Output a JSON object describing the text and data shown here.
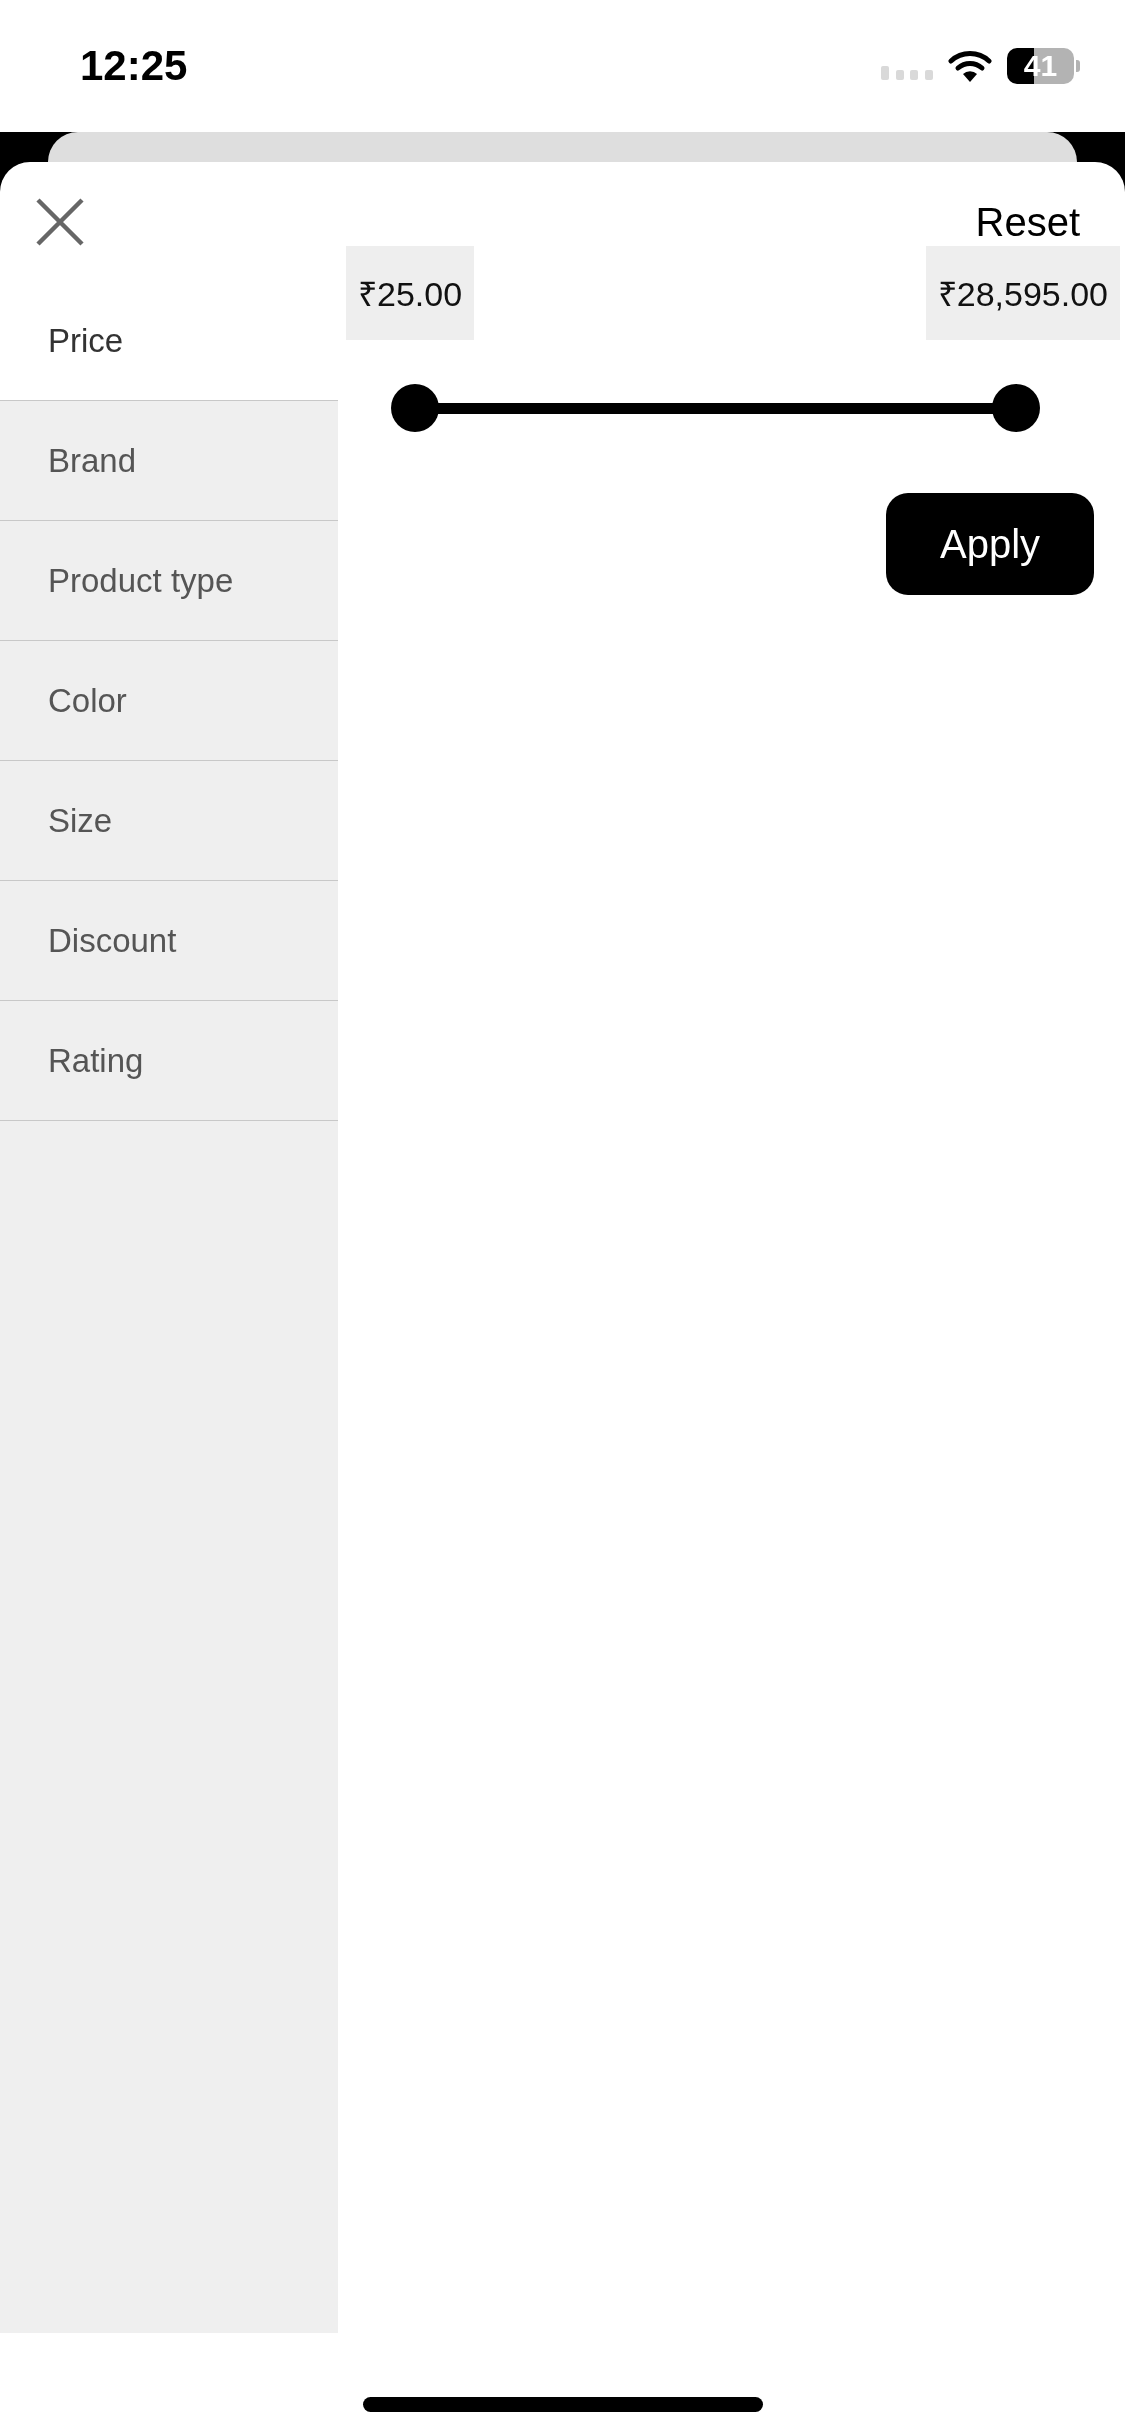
{
  "status_bar": {
    "time": "12:25",
    "battery": "41"
  },
  "header": {
    "reset": "Reset"
  },
  "filters": [
    {
      "label": "Price",
      "selected": true
    },
    {
      "label": "Brand",
      "selected": false
    },
    {
      "label": "Product type",
      "selected": false
    },
    {
      "label": "Color",
      "selected": false
    },
    {
      "label": "Size",
      "selected": false
    },
    {
      "label": "Discount",
      "selected": false
    },
    {
      "label": "Rating",
      "selected": false
    }
  ],
  "price": {
    "min": "₹25.00",
    "max": "₹28,595.00",
    "thumbs": [
      {
        "level": 0
      },
      {
        "level": 1
      }
    ],
    "apply": "Apply"
  }
}
